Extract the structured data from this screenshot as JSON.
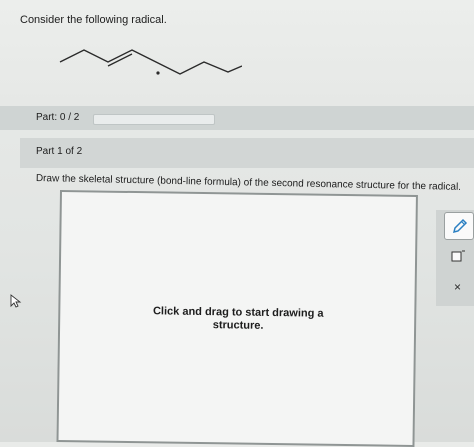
{
  "question": {
    "prompt": "Consider the following radical."
  },
  "progress": {
    "label": "Part: 0 / 2",
    "completed": 0,
    "total": 2
  },
  "part": {
    "title": "Part 1 of 2",
    "instruction": "Draw the skeletal structure (bond-line formula) of the second resonance structure for the radical."
  },
  "canvas": {
    "prompt_line1": "Click and drag to start drawing a",
    "prompt_line2": "structure."
  },
  "toolbar": {
    "items": [
      {
        "name": "pencil-icon"
      },
      {
        "name": "eraser-icon"
      },
      {
        "name": "close-icon",
        "glyph": "×"
      }
    ]
  },
  "colors": {
    "accent": "#2a7fc2",
    "panel": "#d2d6d5"
  }
}
